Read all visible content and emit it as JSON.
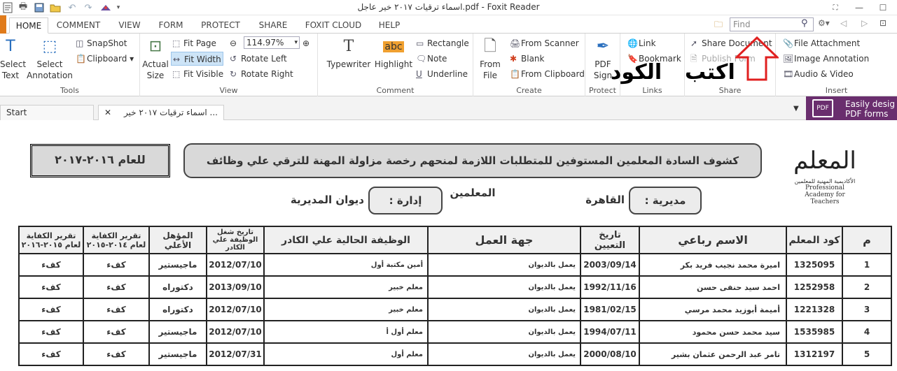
{
  "window": {
    "title": "اسماء ترقيات ٢٠١٧ خير عاجل.pdf - Foxit Reader"
  },
  "menu": {
    "file_tab": "",
    "tabs": [
      "HOME",
      "COMMENT",
      "VIEW",
      "FORM",
      "PROTECT",
      "SHARE",
      "FOXIT CLOUD",
      "HELP"
    ],
    "active_tab": "HOME",
    "find_placeholder": "Find"
  },
  "ribbon": {
    "tools": {
      "label": "Tools",
      "select_text": "Select Text",
      "select_annotation": "Select Annotation",
      "snapshot": "SnapShot",
      "clipboard": "Clipboard"
    },
    "view": {
      "label": "View",
      "actual_size": "Actual Size",
      "fit_page": "Fit Page",
      "fit_width": "Fit Width",
      "fit_visible": "Fit Visible",
      "zoom": "114.97%",
      "rotate_left": "Rotate Left",
      "rotate_right": "Rotate Right"
    },
    "comment": {
      "label": "Comment",
      "typewriter": "Typewriter",
      "highlight": "Highlight",
      "rectangle": "Rectangle",
      "note": "Note",
      "underline": "Underline"
    },
    "create": {
      "label": "Create",
      "from_file": "From File",
      "from_scanner": "From Scanner",
      "blank": "Blank",
      "from_clipboard": "From Clipboard"
    },
    "protect": {
      "label": "Protect",
      "pdf_sign": "PDF Sign"
    },
    "links": {
      "label": "Links",
      "link": "Link",
      "bookmark": "Bookmark"
    },
    "share": {
      "label": "Share",
      "share_document": "Share Document",
      "publish_form": "Publish Form"
    },
    "insert": {
      "label": "Insert",
      "file_attachment": "File Attachment",
      "image_annotation": "Image Annotation",
      "audio_video": "Audio & Video"
    }
  },
  "overlay": {
    "left_word": "الكود",
    "right_word": "اكتب"
  },
  "doc_tabs": {
    "start": "Start",
    "file_tab": "... اسماء ترقيات ٢٠١٧ خير",
    "promo_line1": "Easily desig",
    "promo_line2": "PDF forms",
    "promo_icon": "PDF"
  },
  "document": {
    "header": "كشوف السادة المعلمين المستوفين للمتطلبات اللازمة لمنحهم رخصة مزاولة المهنة للترقي علي وظائف المعلمين",
    "year_box": "للعام ٢٠١٦-٢٠١٧",
    "directorate_label": "مديرية :",
    "directorate_value": "القاهرة",
    "administration_label": "إدارة :",
    "administration_value": "ديوان المديرية",
    "logo_ar": "المعلم",
    "logo_sub": "الأكاديمية المهنية للمعلمين",
    "logo_en": "Professional Academy for Teachers",
    "columns": [
      "م",
      "كود المعلم",
      "الاسم رباعي",
      "تاريخ التعيين",
      "جهة العمل",
      "الوظيفة الحالية علي الكادر",
      "تاريخ شغل الوظيفة علي الكادر",
      "المؤهل الأعلي",
      "تقرير الكفاية لعام ٢٠١٤-٢٠١٥",
      "تقرير الكفاية لعام ٢٠١٥-٢٠١٦"
    ],
    "rows": [
      [
        "1",
        "1325095",
        "اميرة محمد نجيب فريد بكر",
        "2003/09/14",
        "يعمل بالديوان",
        "أمين مكتبة أول",
        "2012/07/10",
        "ماجيستير",
        "كفء",
        "كفء"
      ],
      [
        "2",
        "1252958",
        "احمد سيد حنفى حسن",
        "1992/11/16",
        "يعمل بالديوان",
        "معلم خبير",
        "2013/09/10",
        "دكتوراه",
        "كفء",
        "كفء"
      ],
      [
        "3",
        "1221328",
        "أميمة أبوزيد محمد مرسي",
        "1981/02/15",
        "يعمل بالديوان",
        "معلم خبير",
        "2012/07/10",
        "دكتوراه",
        "كفء",
        "كفء"
      ],
      [
        "4",
        "1535985",
        "سيد محمد حسن محمود",
        "1994/07/11",
        "يعمل بالديوان",
        "معلم أول أ",
        "2012/07/10",
        "ماجيستير",
        "كفء",
        "كفء"
      ],
      [
        "5",
        "1312197",
        "تامر عبد الرحمن عثمان بشير",
        "2000/08/10",
        "يعمل بالديوان",
        "معلم أول",
        "2012/07/31",
        "ماجيستير",
        "كفء",
        "كفء"
      ]
    ]
  }
}
